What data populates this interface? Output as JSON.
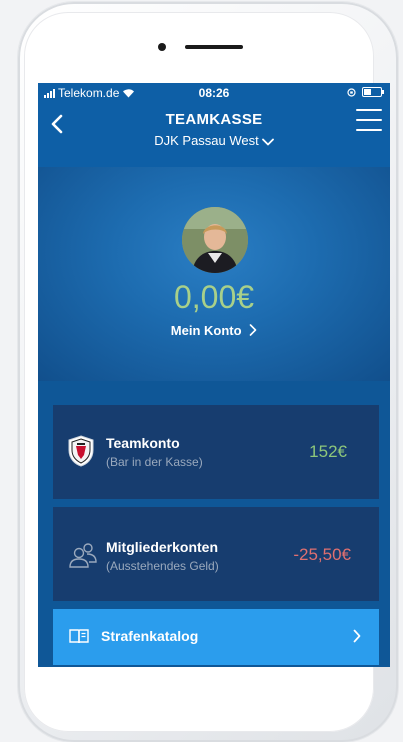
{
  "status_bar": {
    "carrier": "Telekom.de",
    "time": "08:26"
  },
  "header": {
    "title": "TEAMKASSE",
    "club": "DJK Passau West"
  },
  "profile": {
    "balance": "0,00€",
    "account_link": "Mein Konto"
  },
  "cards": [
    {
      "title": "Teamkonto",
      "subtitle": "(Bar in der Kasse)",
      "amount": "152€",
      "amount_color": "#8ec77b"
    },
    {
      "title": "Mitgliederkonten",
      "subtitle": "(Ausstehendes Geld)",
      "amount": "-25,50€",
      "amount_color": "#e07070"
    }
  ],
  "catalog": {
    "label": "Strafenkatalog"
  },
  "icons": [
    "back-chevron-icon",
    "menu-icon",
    "chevron-down-icon",
    "crest-icon",
    "people-icon",
    "book-icon",
    "chevron-right-icon",
    "wifi-icon",
    "battery-icon"
  ]
}
